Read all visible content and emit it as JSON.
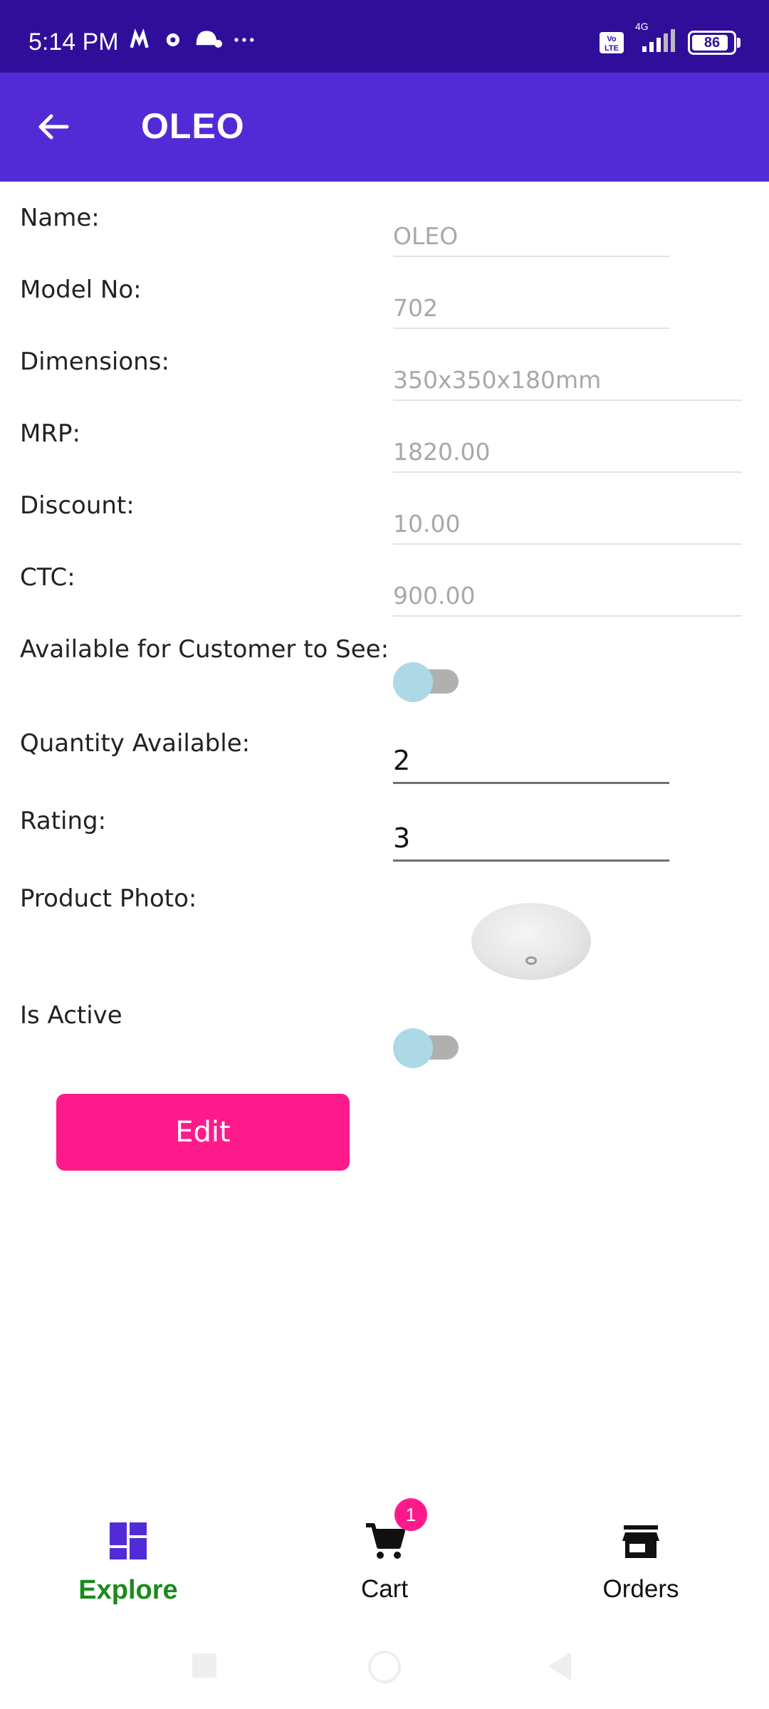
{
  "status_bar": {
    "time": "5:14 PM",
    "network": "4G",
    "volte": "Vo LTE",
    "battery": "86"
  },
  "app_bar": {
    "title": "OLEO"
  },
  "form": {
    "name_label": "Name:",
    "name_value": "OLEO",
    "model_label": "Model No:",
    "model_value": "702",
    "dimensions_label": "Dimensions:",
    "dimensions_value": "350x350x180mm",
    "mrp_label": "MRP:",
    "mrp_value": "1820.00",
    "discount_label": "Discount:",
    "discount_value": "10.00",
    "ctc_label": "CTC:",
    "ctc_value": "900.00",
    "available_label": "Available for Customer to See:",
    "available_on": false,
    "quantity_label": "Quantity Available:",
    "quantity_value": "2",
    "rating_label": "Rating:",
    "rating_value": "3",
    "photo_label": "Product Photo:",
    "active_label": "Is Active",
    "active_on": false,
    "edit_label": "Edit"
  },
  "bottom_nav": {
    "explore_label": "Explore",
    "cart_label": "Cart",
    "cart_badge": "1",
    "orders_label": "Orders"
  },
  "colors": {
    "status_bar": "#2f0f9a",
    "app_bar": "#522bd6",
    "edit_button": "#ff1a8c",
    "active_nav": "#1a8a1a"
  }
}
